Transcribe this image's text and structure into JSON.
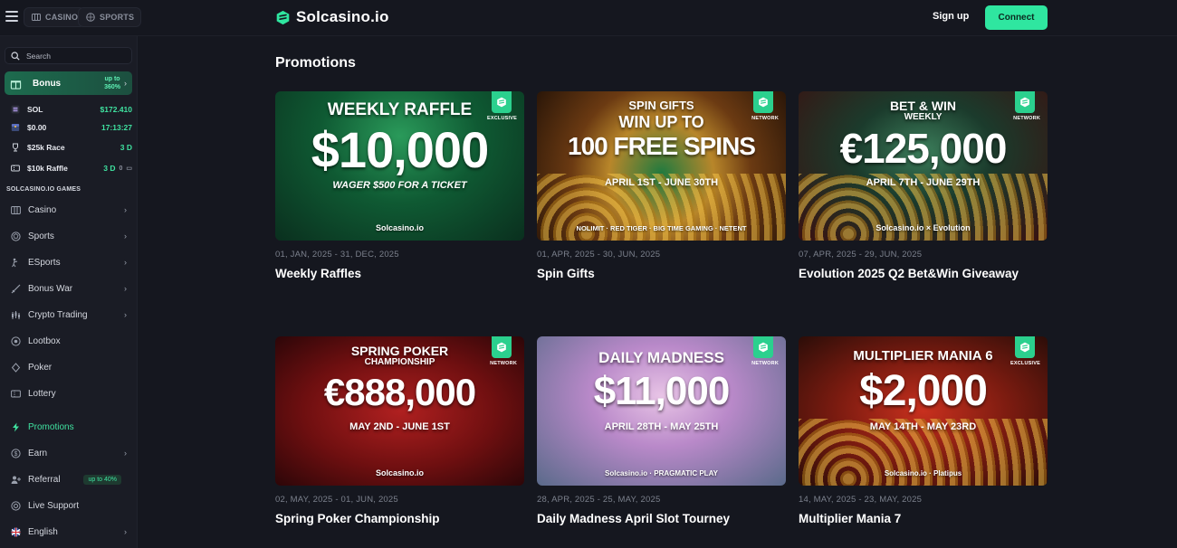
{
  "header": {
    "tabs": [
      {
        "label": "CASINO"
      },
      {
        "label": "SPORTS"
      }
    ],
    "brand": "Solcasino.io",
    "signup_label": "Sign up",
    "connect_label": "Connect"
  },
  "sidebar": {
    "search_placeholder": "Search",
    "bonus": {
      "label": "Bonus",
      "upto_line1": "up to",
      "upto_line2": "360%"
    },
    "stats": [
      {
        "name": "SOL",
        "value": "$172.410",
        "icon": "solana-icon"
      },
      {
        "name": "$0.00",
        "value": "17:13:27",
        "icon": "chest-icon"
      },
      {
        "name": "$25k Race",
        "value": "3 D",
        "icon": "trophy-icon"
      },
      {
        "name": "$10k Raffle",
        "value": "3 D",
        "extra": "0",
        "icon": "ticket-icon"
      }
    ],
    "section_title": "SOLCASINO.IO GAMES",
    "items": [
      {
        "label": "Casino",
        "icon": "casino-icon",
        "chevron": true
      },
      {
        "label": "Sports",
        "icon": "ball-icon",
        "chevron": true
      },
      {
        "label": "ESports",
        "icon": "esports-icon",
        "chevron": true
      },
      {
        "label": "Bonus War",
        "icon": "sword-icon",
        "chevron": true
      },
      {
        "label": "Crypto Trading",
        "icon": "chart-icon",
        "chevron": true
      },
      {
        "label": "Lootbox",
        "icon": "lootbox-icon",
        "chevron": false
      },
      {
        "label": "Poker",
        "icon": "poker-icon",
        "chevron": false
      },
      {
        "label": "Lottery",
        "icon": "lottery-icon",
        "chevron": false
      }
    ],
    "bottom_items": [
      {
        "label": "Promotions",
        "icon": "bolt-icon",
        "chevron": false,
        "active": true
      },
      {
        "label": "Earn",
        "icon": "earn-icon",
        "chevron": true
      },
      {
        "label": "Referral",
        "icon": "referral-icon",
        "chevron": false,
        "pill": "up to 40%"
      },
      {
        "label": "Live Support",
        "icon": "support-icon",
        "chevron": false
      },
      {
        "label": "English",
        "icon": "flag-uk-icon",
        "chevron": true
      }
    ]
  },
  "main": {
    "title": "Promotions",
    "promos": [
      {
        "title": "Weekly Raffles",
        "date": "01, JAN, 2025 - 31, DEC, 2025",
        "banner": {
          "line1": "WEEKLY RAFFLE",
          "amount": "$10,000",
          "line3": "WAGER $500 FOR A TICKET",
          "tag": "EXCLUSIVE",
          "brand": "Solcasino.io"
        }
      },
      {
        "title": "Spin Gifts",
        "date": "01, APR, 2025 - 30, JUN, 2025",
        "banner": {
          "line1": "SPIN GIFTS",
          "line2": "WIN UP TO",
          "amount": "100 FREE SPINS",
          "line3": "APRIL 1ST - JUNE 30TH",
          "tag": "NETWORK",
          "brand": "NOLIMIT · RED TIGER · BIG TIME GAMING · NETENT"
        }
      },
      {
        "title": "Evolution 2025 Q2 Bet&Win Giveaway",
        "date": "07, APR, 2025 - 29, JUN, 2025",
        "banner": {
          "line1": "BET & WIN",
          "line2": "WEEKLY",
          "amount": "€125,000",
          "line3": "APRIL 7TH - JUNE 29TH",
          "tag": "NETWORK",
          "brand": "Solcasino.io × Evolution"
        }
      },
      {
        "title": "Spring Poker Championship",
        "date": "02, MAY, 2025 - 01, JUN, 2025",
        "banner": {
          "line1": "SPRING POKER",
          "line2": "CHAMPIONSHIP",
          "amount": "€888,000",
          "line3": "MAY 2ND - JUNE 1ST",
          "tag": "NETWORK",
          "brand": "Solcasino.io"
        }
      },
      {
        "title": "Daily Madness April Slot Tourney",
        "date": "28, APR, 2025 - 25, MAY, 2025",
        "banner": {
          "line1": "DAILY MADNESS",
          "amount": "$11,000",
          "line3": "APRIL 28TH - MAY 25TH",
          "tag": "NETWORK",
          "brand": "Solcasino.io · PRAGMATIC PLAY"
        }
      },
      {
        "title": "Multiplier Mania 7",
        "date": "14, MAY, 2025 - 23, MAY, 2025",
        "banner": {
          "line1": "MULTIPLIER MANIA 6",
          "amount": "$2,000",
          "line3": "MAY 14TH - MAY 23RD",
          "tag": "EXCLUSIVE",
          "brand": "Solcasino.io · Platipus"
        }
      }
    ]
  },
  "colors": {
    "accent": "#2fe6a0",
    "background": "#15171f",
    "sidebar": "#1a1c25"
  }
}
